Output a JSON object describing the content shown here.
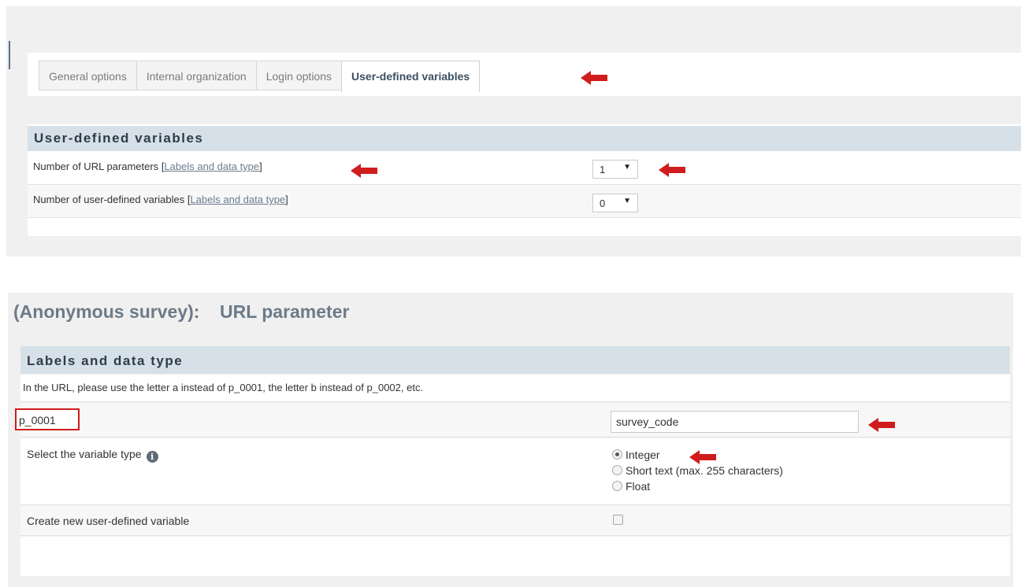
{
  "tabs": [
    {
      "label": "General options",
      "active": false
    },
    {
      "label": "Internal organization",
      "active": false
    },
    {
      "label": "Login options",
      "active": false
    },
    {
      "label": "User-defined variables",
      "active": true
    }
  ],
  "user_defined_section": {
    "title": "User-defined variables",
    "rows": [
      {
        "label": "Number of URL parameters ",
        "bracket_open": "[",
        "link": "Labels and data type",
        "bracket_close": "]",
        "value": "1"
      },
      {
        "label": "Number of user-defined variables ",
        "bracket_open": "[",
        "link": "Labels and data type",
        "bracket_close": "]",
        "value": "0"
      }
    ]
  },
  "page_title": "(Anonymous survey):    URL parameter",
  "labels_section": {
    "title": "Labels and data type",
    "info_text": "In the URL, please use the letter a instead of p_0001, the letter b instead of p_0002, etc.",
    "param_name": "p_0001",
    "param_label_value": "survey_code",
    "type_label": "Select the variable type",
    "info_icon_glyph": "i",
    "type_options": [
      {
        "label": "Integer",
        "checked": true
      },
      {
        "label": "Short text (max. 255 characters)",
        "checked": false
      },
      {
        "label": "Float",
        "checked": false
      }
    ],
    "create_label": "Create new user-defined variable",
    "create_checked": false
  },
  "colors": {
    "annotation_red": "#d01c1c",
    "section_header_bg": "#d6e0e8",
    "title_gray": "#6d7b88"
  }
}
